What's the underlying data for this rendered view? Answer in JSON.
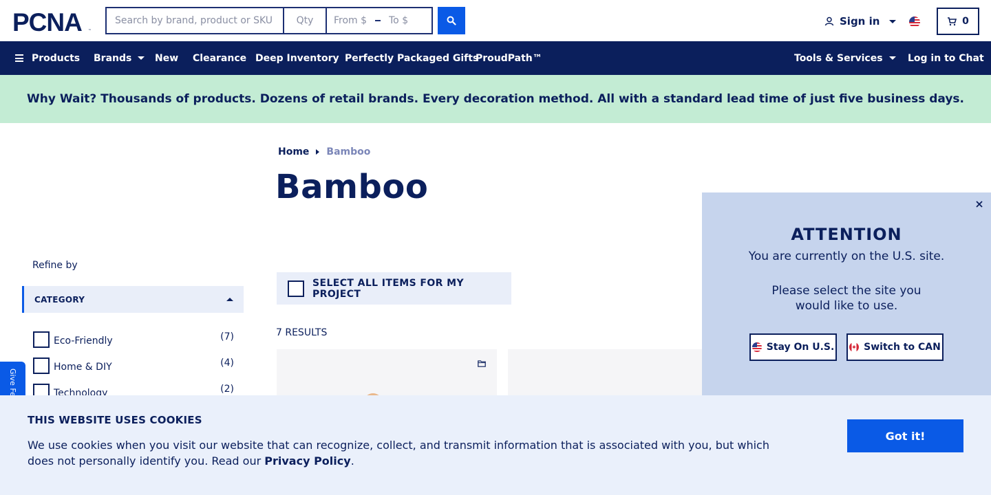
{
  "header": {
    "logo_text": "PCNA",
    "search": {
      "placeholder": "Search by brand, product or SKU",
      "value": ""
    },
    "qty": {
      "placeholder": "Qty"
    },
    "price_from": {
      "placeholder": "From $"
    },
    "price_to": {
      "placeholder": "To $"
    },
    "sign_in_label": "Sign in",
    "cart_count": "0"
  },
  "nav": {
    "products": "Products",
    "brands": "Brands",
    "new": "New",
    "clearance": "Clearance",
    "deep_inventory": "Deep Inventory",
    "gifts": "Perfectly Packaged Gifts",
    "proudpath": "ProudPath™",
    "tools": "Tools & Services",
    "chat": "Log in to Chat"
  },
  "promo_text": "Why Wait? Thousands of products. Dozens of retail brands. Every decoration method. All with a standard lead time of just five business days.",
  "breadcrumb": {
    "home": "Home",
    "current": "Bamboo"
  },
  "page_title": "Bamboo",
  "sidebar": {
    "refine_label": "Refine by",
    "category_header": "CATEGORY",
    "items": [
      {
        "label": "Eco-Friendly",
        "count": "(7)"
      },
      {
        "label": "Home & DIY",
        "count": "(4)"
      },
      {
        "label": "Technology",
        "count": "(2)"
      }
    ]
  },
  "feedback_label": "Give Feedback",
  "main": {
    "select_all_label": "SELECT ALL ITEMS FOR MY PROJECT",
    "results_label": "7 RESULTS"
  },
  "attention": {
    "title": "ATTENTION",
    "line1": "You are currently on the U.S. site.",
    "line2": "Please select the site you would like to use.",
    "stay_label": "Stay On U.S.",
    "switch_label": "Switch to CAN"
  },
  "cookie": {
    "title": "THIS WEBSITE USES COOKIES",
    "text": "We use cookies when you visit our website that can recognize, collect, and transmit information that is associated with you, but which does not personally identify you. Read our ",
    "link_label": "Privacy Policy",
    "period": ".",
    "button_label": "Got it!"
  },
  "colors": {
    "navy": "#0b1f5c",
    "accent_blue": "#0a5ae6",
    "promo_green": "#c3ecd4",
    "modal_bg": "#c6d4ed",
    "cookie_bg": "#eaf0fb"
  }
}
